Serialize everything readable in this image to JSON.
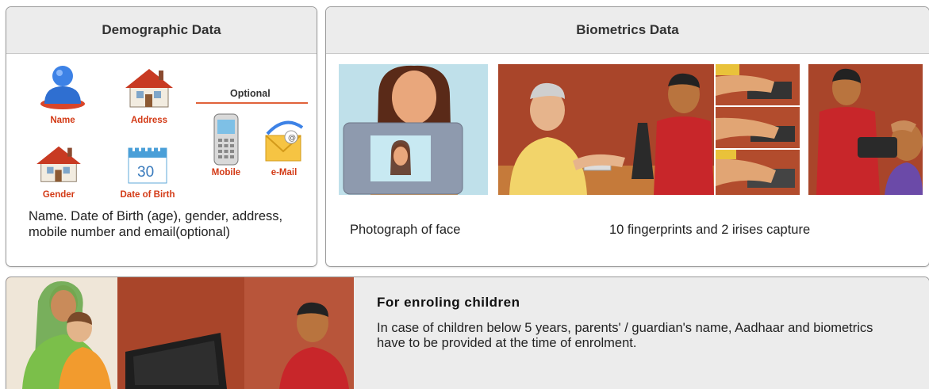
{
  "demographic": {
    "title": "Demographic Data",
    "items": {
      "name": "Name",
      "address": "Address",
      "gender": "Gender",
      "dob": "Date of Birth",
      "mobile": "Mobile",
      "email": "e-Mail"
    },
    "calendar_day": "30",
    "optional_heading": "Optional",
    "description": "Name. Date of Birth (age), gender, address, mobile number and email(optional)"
  },
  "biometrics": {
    "title": "Biometrics Data",
    "caption_face": "Photograph of face",
    "caption_prints": "10 fingerprints and 2 irises capture"
  },
  "children": {
    "title": "For enroling children",
    "text": "In case of children below 5 years, parents' / guardian's name, Aadhaar and biometrics have to be provided at the time of enrolment."
  },
  "colors": {
    "accent": "#d33a16",
    "header_bg": "#ececec",
    "photo_wall": "#a9452a"
  }
}
